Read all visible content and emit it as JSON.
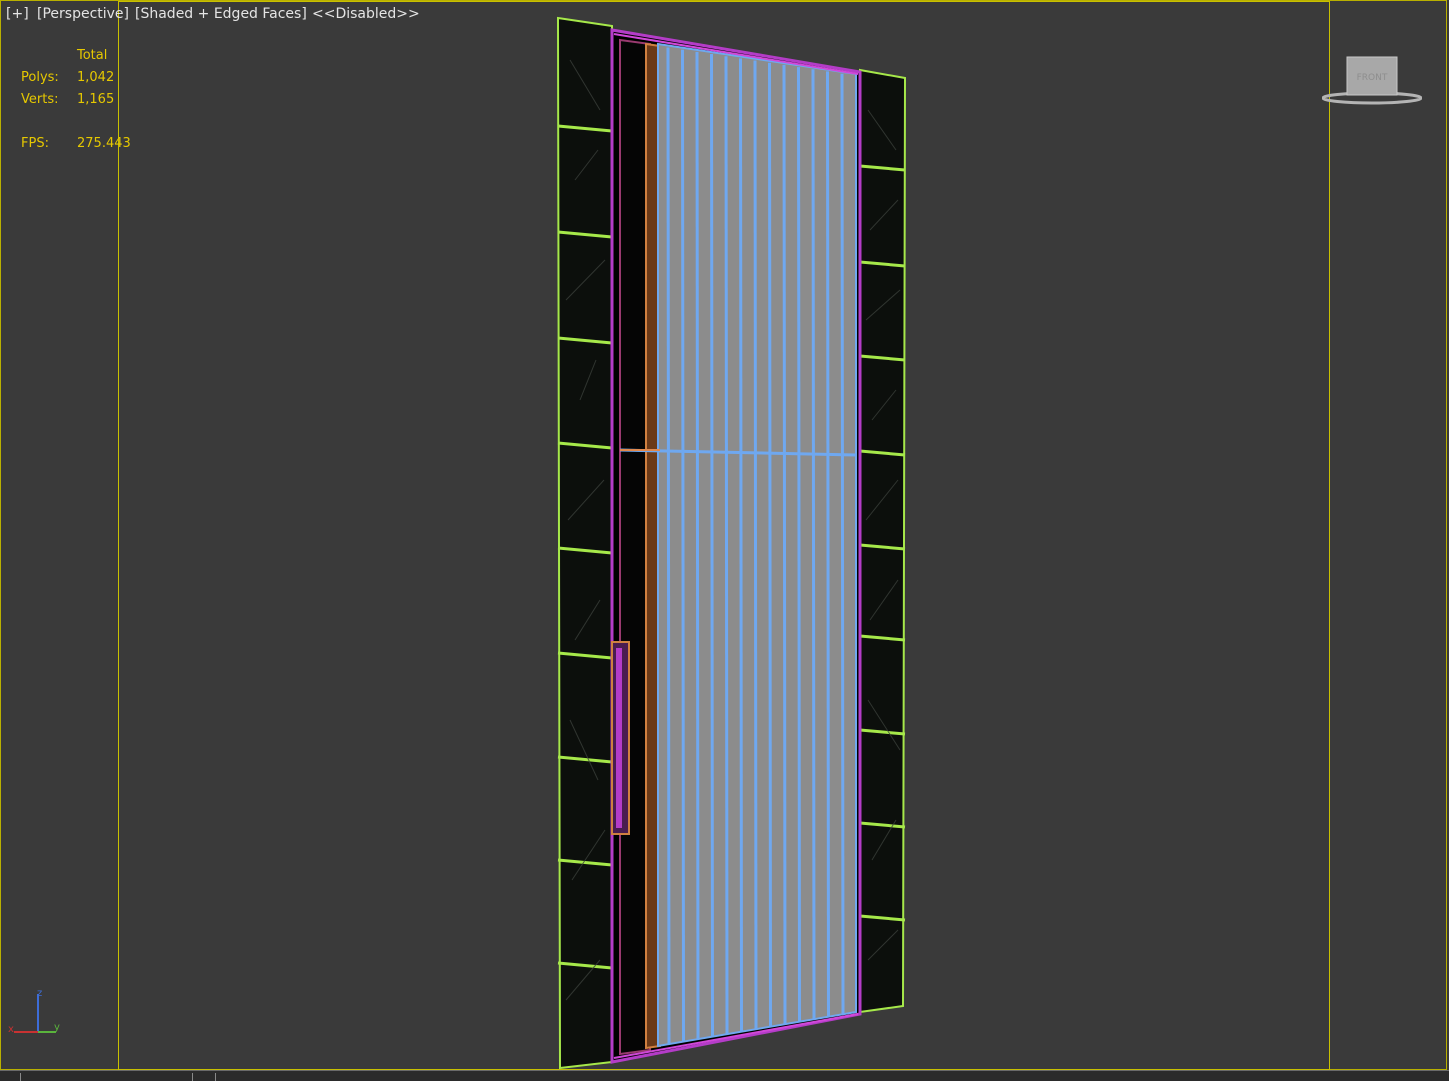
{
  "viewport": {
    "labels": {
      "plus": "[+]",
      "view": "[Perspective]",
      "shading": "[Shaded + Edged Faces]",
      "state": "<<Disabled>>"
    },
    "stats": {
      "header": "Total",
      "polys_label": "Polys:",
      "polys_value": "1,042",
      "verts_label": "Verts:",
      "verts_value": "1,165",
      "fps_label": "FPS:",
      "fps_value": "275.443"
    },
    "viewcube_face": "FRONT",
    "axis_labels": {
      "x": "x",
      "y": "y",
      "z": "z"
    }
  },
  "colors": {
    "background": "#3a3a3a",
    "frame": "#c8c000",
    "stats_text": "#e6c800",
    "label_text": "#e4e4e4",
    "panel_edge": "#a6e84a",
    "panel_fill": "#0c0f0c",
    "glass_fill": "#8c8c8c",
    "glass_edge": "#6fa8f0",
    "door_outline": "#b43cc8",
    "wood_edge": "#d08040"
  }
}
